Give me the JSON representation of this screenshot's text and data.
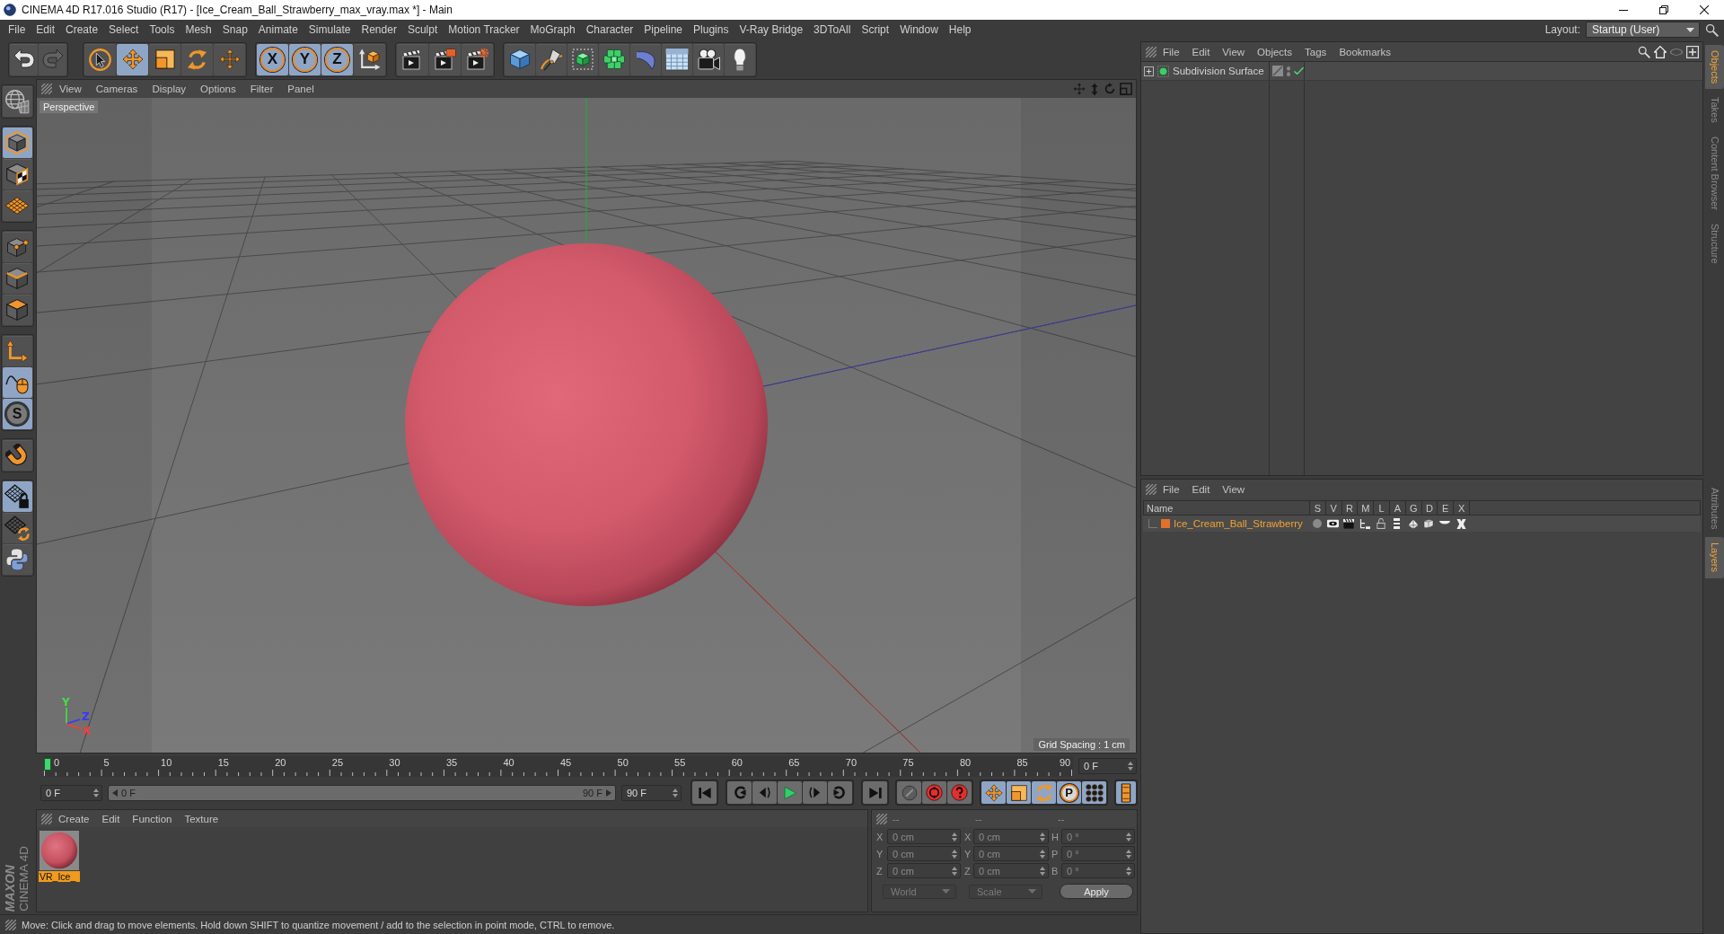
{
  "window": {
    "title": "CINEMA 4D R17.016 Studio (R17) - [Ice_Cream_Ball_Strawberry_max_vray.max *] - Main"
  },
  "menu_bar": [
    "File",
    "Edit",
    "Create",
    "Select",
    "Tools",
    "Mesh",
    "Snap",
    "Animate",
    "Simulate",
    "Render",
    "Sculpt",
    "Motion Tracker",
    "MoGraph",
    "Character",
    "Pipeline",
    "Plugins",
    "V-Ray Bridge",
    "3DToAll",
    "Script",
    "Window",
    "Help"
  ],
  "layout": {
    "label": "Layout:",
    "value": "Startup (User)"
  },
  "toolbar": [
    [
      {
        "kind": "undo",
        "disabled": false
      },
      {
        "kind": "redo",
        "disabled": true
      }
    ],
    [
      {
        "kind": "select",
        "selected": false
      },
      {
        "kind": "move",
        "selected": true
      },
      {
        "kind": "scale",
        "selected": false
      },
      {
        "kind": "rotate",
        "selected": false
      },
      {
        "kind": "recent",
        "selected": false
      }
    ],
    [
      {
        "kind": "axis",
        "label": "X",
        "selected": true
      },
      {
        "kind": "axis",
        "label": "Y",
        "selected": true
      },
      {
        "kind": "axis",
        "label": "Z",
        "selected": true
      },
      {
        "kind": "coordinates",
        "selected": false
      }
    ],
    [
      {
        "kind": "render"
      },
      {
        "kind": "viewer"
      },
      {
        "kind": "settings"
      }
    ],
    [
      {
        "kind": "cube"
      },
      {
        "kind": "pen"
      },
      {
        "kind": "subdivision"
      },
      {
        "kind": "cloner"
      },
      {
        "kind": "deformer"
      },
      {
        "kind": "floor"
      },
      {
        "kind": "camera"
      },
      {
        "kind": "light"
      }
    ]
  ],
  "tool_palette": [
    [
      {
        "kind": "editable",
        "selected": false
      }
    ],
    [
      {
        "kind": "model",
        "selected": true
      },
      {
        "kind": "texture",
        "selected": false
      },
      {
        "kind": "workplane",
        "selected": false
      }
    ],
    [
      {
        "kind": "points",
        "selected": false
      },
      {
        "kind": "edges",
        "selected": false
      },
      {
        "kind": "polygons",
        "selected": false
      }
    ],
    [
      {
        "kind": "axes",
        "selected": false
      },
      {
        "kind": "tweak",
        "selected": true
      },
      {
        "kind": "snap",
        "label": "S",
        "selected": true
      }
    ],
    [
      {
        "kind": "magnet",
        "selected": false
      }
    ],
    [
      {
        "kind": "lock",
        "selected": true
      },
      {
        "kind": "sync",
        "selected": false
      },
      {
        "kind": "python",
        "selected": false
      }
    ]
  ],
  "logo": {
    "brand": "MAXON",
    "product": "CINEMA 4D"
  },
  "viewport": {
    "menu": [
      "View",
      "Cameras",
      "Display",
      "Options",
      "Filter",
      "Panel"
    ],
    "camera": "Perspective",
    "grid_spacing": "Grid Spacing : 1 cm",
    "axis_gizmo": [
      {
        "label": "Y",
        "color": "#44e044"
      },
      {
        "label": "Z",
        "color": "#3838ff"
      },
      {
        "label": "X",
        "color": "#ff3a3a"
      }
    ]
  },
  "timeline": {
    "ticks": [
      "0",
      "5",
      "10",
      "15",
      "20",
      "25",
      "30",
      "35",
      "40",
      "45",
      "50",
      "55",
      "60",
      "65",
      "70",
      "75",
      "80",
      "85",
      "90"
    ],
    "level": 0,
    "frame": "0 F"
  },
  "playback": {
    "start": "0 F",
    "range": {
      "start": "0 F",
      "end": "90 F"
    },
    "end": "90 F",
    "key_tools": [
      {
        "kind": "move",
        "selected": true
      },
      {
        "kind": "scale",
        "selected": true
      },
      {
        "kind": "rotate",
        "selected": true
      },
      {
        "kind": "param",
        "label": "P",
        "selected": true
      },
      {
        "kind": "points",
        "selected": true
      }
    ],
    "timeline_toggle": {
      "selected": true
    }
  },
  "material_manager": {
    "menu": [
      "Create",
      "Edit",
      "Function",
      "Texture"
    ],
    "materials": [
      {
        "name": "VR_Ice_",
        "selected": true
      }
    ]
  },
  "coordinates": {
    "headers": [
      "--",
      "--",
      "--"
    ],
    "rows": [
      {
        "axis": "X",
        "position": "0 cm",
        "size_axis": "X",
        "size": "0 cm",
        "rotation_axis": "H",
        "rotation": "0 °"
      },
      {
        "axis": "Y",
        "position": "0 cm",
        "size_axis": "Y",
        "size": "0 cm",
        "rotation_axis": "P",
        "rotation": "0 °"
      },
      {
        "axis": "Z",
        "position": "0 cm",
        "size_axis": "Z",
        "size": "0 cm",
        "rotation_axis": "B",
        "rotation": "0 °"
      }
    ],
    "mode": "World",
    "transform": "Scale",
    "apply": "Apply"
  },
  "object_manager": {
    "menu": [
      "File",
      "Edit",
      "View",
      "Objects",
      "Tags",
      "Bookmarks"
    ],
    "objects": [
      {
        "name": "Subdivision Surface",
        "enabled": true,
        "expanded": false
      }
    ]
  },
  "layer_manager": {
    "menu": [
      "File",
      "Edit",
      "View"
    ],
    "columns": [
      "Name",
      "S",
      "V",
      "R",
      "M",
      "L",
      "A",
      "G",
      "D",
      "E",
      "X"
    ],
    "layers": [
      {
        "name": "Ice_Cream_Ball_Strawberry",
        "color": "#e0702a"
      }
    ]
  },
  "side_tabs": {
    "top": [
      {
        "label": "Objects",
        "selected": true
      },
      {
        "label": "Takes",
        "selected": false
      },
      {
        "label": "Content Browser",
        "selected": false
      },
      {
        "label": "Structure",
        "selected": false
      }
    ],
    "bottom": [
      {
        "label": "Attributes",
        "selected": false
      },
      {
        "label": "Layers",
        "selected": true
      }
    ]
  },
  "status_bar": "Move: Click and drag to move elements. Hold down SHIFT to quantize movement / add to the selection in point mode, CTRL to remove."
}
